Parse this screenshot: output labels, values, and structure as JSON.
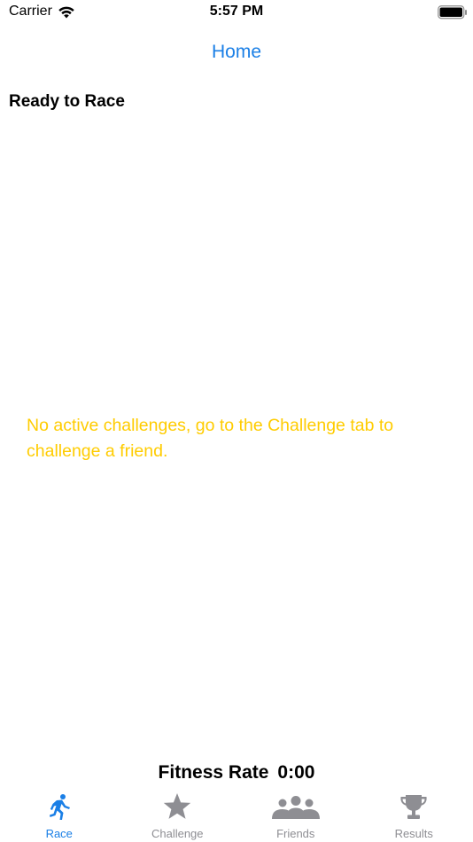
{
  "status_bar": {
    "carrier": "Carrier",
    "time": "5:57 PM"
  },
  "nav": {
    "title": "Home"
  },
  "section": {
    "title": "Ready to Race"
  },
  "empty_state": {
    "message": "No active challenges, go to the Challenge tab to challenge a friend."
  },
  "fitness": {
    "label": "Fitness Rate",
    "value": "0:00"
  },
  "tabs": [
    {
      "label": "Race",
      "icon": "runner-icon",
      "active": true
    },
    {
      "label": "Challenge",
      "icon": "star-icon",
      "active": false
    },
    {
      "label": "Friends",
      "icon": "people-icon",
      "active": false
    },
    {
      "label": "Results",
      "icon": "trophy-icon",
      "active": false
    }
  ],
  "colors": {
    "accent": "#1a7fe6",
    "warning_text": "#ffcc00",
    "inactive_tab": "#8e8e93"
  }
}
